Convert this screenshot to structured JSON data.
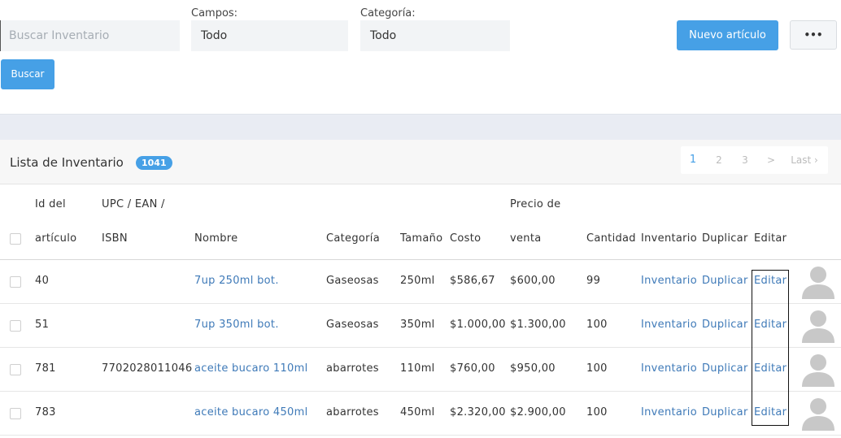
{
  "search": {
    "placeholder": "Buscar Inventario",
    "button_label": "Buscar"
  },
  "filters": {
    "campos_label": "Campos:",
    "campos_value": "Todo",
    "categoria_label": "Categoría:",
    "categoria_value": "Todo"
  },
  "toolbar": {
    "new_item_label": "Nuevo artículo",
    "more_label": "•••"
  },
  "panel": {
    "title": "Lista de Inventario",
    "count": "1041"
  },
  "pagination": {
    "pages": [
      "1",
      "2",
      "3"
    ],
    "next": ">",
    "last": "Last ›",
    "current": "1"
  },
  "table": {
    "headers": {
      "id_line1": "Id del",
      "id_line2": "artículo",
      "upc_line1": "UPC / EAN /",
      "upc_line2": "ISBN",
      "nombre": "Nombre",
      "categoria": "Categoría",
      "tamano": "Tamaño",
      "costo": "Costo",
      "precio_line1": "Precio de",
      "precio_line2": "venta",
      "cantidad": "Cantidad",
      "inventario": "Inventario",
      "duplicar": "Duplicar",
      "editar": "Editar"
    },
    "rows": [
      {
        "id": "40",
        "upc": "",
        "nombre": "7up 250ml bot.",
        "categoria": "Gaseosas",
        "tamano": "250ml",
        "costo": "$586,67",
        "precio": "$600,00",
        "cantidad": "99",
        "inventario": "Inventario",
        "duplicar": "Duplicar",
        "editar": "Editar"
      },
      {
        "id": "51",
        "upc": "",
        "nombre": "7up 350ml bot.",
        "categoria": "Gaseosas",
        "tamano": "350ml",
        "costo": "$1.000,00",
        "precio": "$1.300,00",
        "cantidad": "100",
        "inventario": "Inventario",
        "duplicar": "Duplicar",
        "editar": "Editar"
      },
      {
        "id": "781",
        "upc": "7702028011046",
        "nombre": "aceite bucaro 110ml",
        "categoria": "abarrotes",
        "tamano": "110ml",
        "costo": "$760,00",
        "precio": "$950,00",
        "cantidad": "100",
        "inventario": "Inventario",
        "duplicar": "Duplicar",
        "editar": "Editar"
      },
      {
        "id": "783",
        "upc": "",
        "nombre": "aceite bucaro 450ml",
        "categoria": "abarrotes",
        "tamano": "450ml",
        "costo": "$2.320,00",
        "precio": "$2.900,00",
        "cantidad": "100",
        "inventario": "Inventario",
        "duplicar": "Duplicar",
        "editar": "Editar"
      }
    ]
  },
  "colors": {
    "accent": "#46a0e6",
    "link": "#3f7ab8",
    "band": "#e9ecf3",
    "avatar": "#c8c8c8"
  }
}
